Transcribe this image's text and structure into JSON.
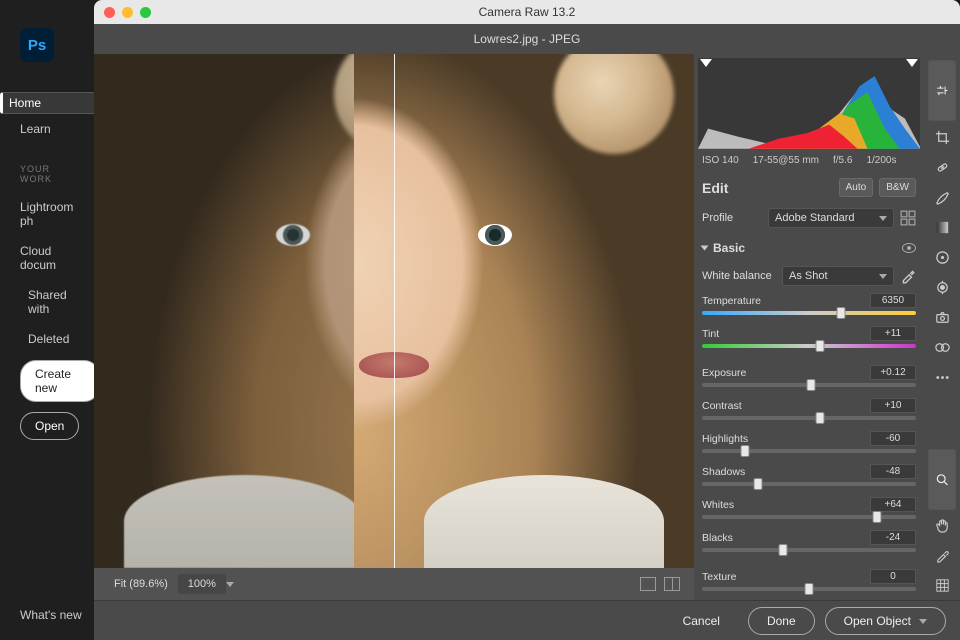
{
  "ps": {
    "logo": "Ps",
    "home": "Home",
    "learn": "Learn",
    "your_work": "YOUR WORK",
    "lightroom": "Lightroom ph",
    "cloud": "Cloud docum",
    "shared": "Shared with",
    "deleted": "Deleted",
    "create": "Create new",
    "open": "Open",
    "whats_new": "What's new"
  },
  "window": {
    "title": "Camera Raw 13.2"
  },
  "file": {
    "name": "Lowres2.jpg",
    "sep": "  -  ",
    "fmt": "JPEG"
  },
  "meta": {
    "iso": "ISO 140",
    "lens": "17-55@55 mm",
    "fstop": "f/5.6",
    "shutter": "1/200s"
  },
  "edit": {
    "title": "Edit",
    "auto": "Auto",
    "bw": "B&W"
  },
  "profile": {
    "label": "Profile",
    "value": "Adobe Standard"
  },
  "basic": {
    "title": "Basic"
  },
  "wb": {
    "label": "White balance",
    "value": "As Shot"
  },
  "sliders": {
    "temperature": {
      "label": "Temperature",
      "value": "6350",
      "pos": 65,
      "cls": "temp"
    },
    "tint": {
      "label": "Tint",
      "value": "+11",
      "pos": 55,
      "cls": "tint"
    },
    "exposure": {
      "label": "Exposure",
      "value": "+0.12",
      "pos": 51
    },
    "contrast": {
      "label": "Contrast",
      "value": "+10",
      "pos": 55
    },
    "highlights": {
      "label": "Highlights",
      "value": "-60",
      "pos": 20
    },
    "shadows": {
      "label": "Shadows",
      "value": "-48",
      "pos": 26
    },
    "whites": {
      "label": "Whites",
      "value": "+64",
      "pos": 82
    },
    "blacks": {
      "label": "Blacks",
      "value": "-24",
      "pos": 38
    },
    "texture": {
      "label": "Texture",
      "value": "0",
      "pos": 50
    }
  },
  "viewbar": {
    "fit": "Fit (89.6%)",
    "zoom": "100%"
  },
  "footer": {
    "cancel": "Cancel",
    "done": "Done",
    "open": "Open Object"
  }
}
